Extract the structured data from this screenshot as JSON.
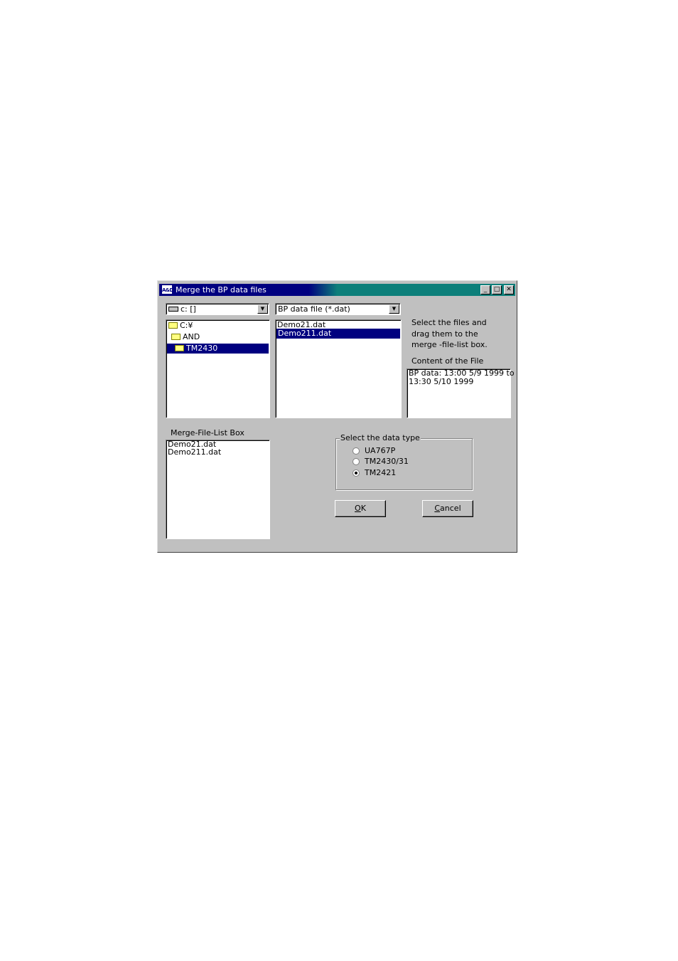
{
  "window": {
    "title": "Merge the BP data files",
    "app_icon_text": "A&D",
    "minimize_glyph": "_",
    "maximize_glyph": "□",
    "close_glyph": "✕"
  },
  "drive_select": {
    "value": "c: []"
  },
  "folder_tree": {
    "items": [
      {
        "label": "C:¥"
      },
      {
        "label": "AND"
      },
      {
        "label": "TM2430"
      }
    ],
    "selected_index": 2
  },
  "filter_select": {
    "value": "BP data file (*.dat)"
  },
  "file_list": {
    "items": [
      "Demo21.dat",
      "Demo211.dat"
    ],
    "selected_index": 1
  },
  "instructions": {
    "line1": "Select the files and",
    "line2": "drag them to the",
    "line3": "merge -file-list box."
  },
  "content": {
    "label": "Content of the File",
    "line1": "BP data:  13:00 5/9 1999 to",
    "line2": "13:30 5/10 1999"
  },
  "merge_list": {
    "label": "Merge-File-List Box",
    "items": [
      "Demo21.dat",
      "Demo211.dat"
    ]
  },
  "data_type": {
    "title": "Select the data type",
    "options": [
      "UA767P",
      "TM2430/31",
      "TM2421"
    ],
    "selected": "TM2421"
  },
  "buttons": {
    "ok_mnemonic": "O",
    "ok_rest": "K",
    "cancel_mnemonic": "C",
    "cancel_rest": "ancel"
  }
}
